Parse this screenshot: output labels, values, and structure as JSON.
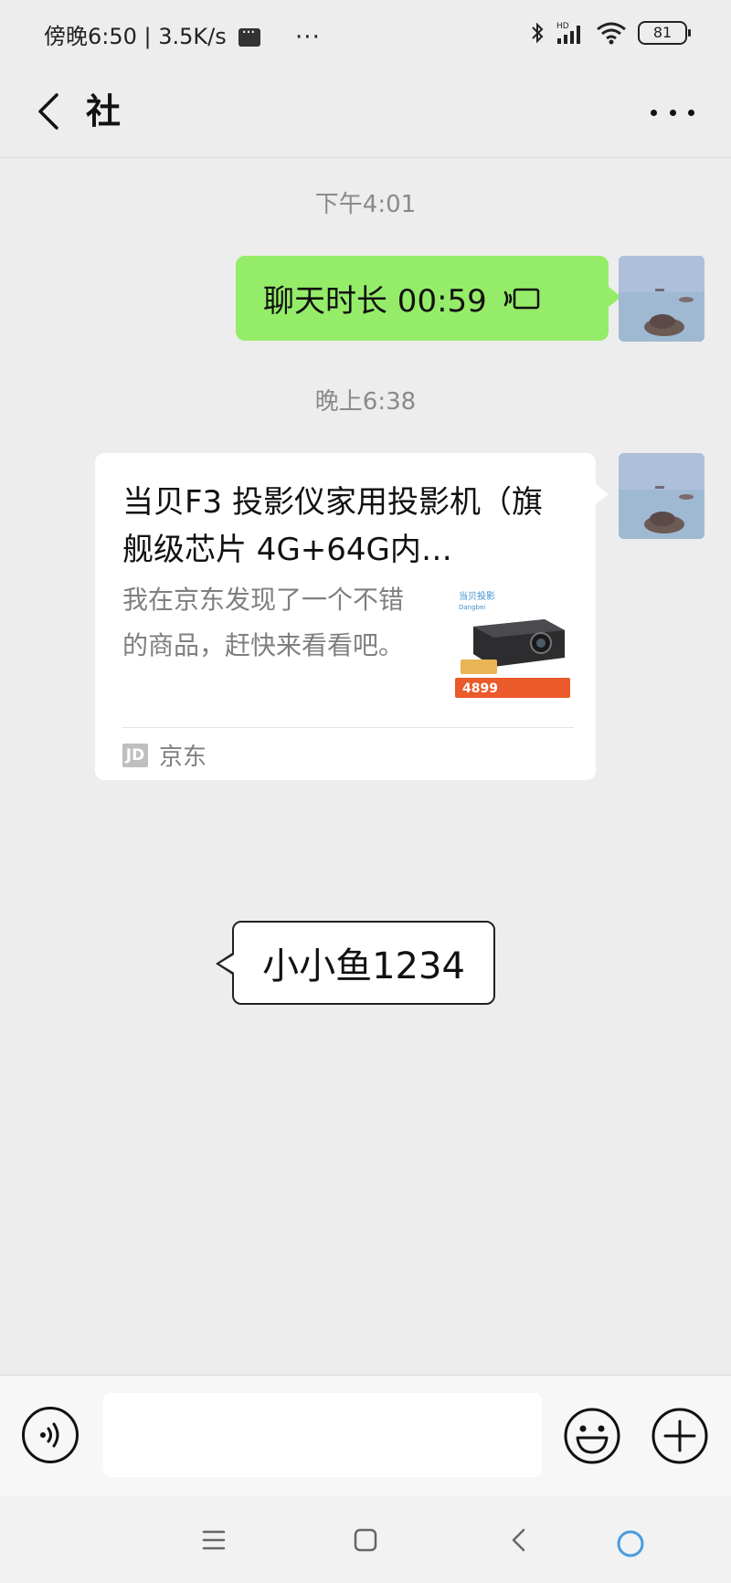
{
  "status_bar": {
    "time": "傍晚6:50",
    "network_speed": "3.5K/s",
    "battery": "81",
    "message_icon": "message-icon",
    "more_icon": "more-dots-icon",
    "bluetooth_icon": "bluetooth-icon",
    "signal_icon": "signal-hd-icon",
    "wifi_icon": "wifi-icon"
  },
  "header": {
    "title": "社",
    "back_icon": "chevron-left-icon",
    "more_icon": "more-horizontal-icon"
  },
  "messages": [
    {
      "type": "timestamp",
      "text": "下午4:01"
    },
    {
      "type": "voice_call",
      "sender": "self",
      "text": "聊天时长 00:59",
      "icon": "call-record-icon",
      "bubble_color": "#95ec69"
    },
    {
      "type": "timestamp",
      "text": "晚上6:38"
    },
    {
      "type": "link_card",
      "sender": "self",
      "title": "当贝F3 投影仪家用投影机（旗舰级芯片 4G+64G内…",
      "description": "我在京东发现了一个不错的商品，赶快来看看吧。",
      "source": "京东",
      "source_logo": "JD",
      "thumbnail": {
        "brand_text": "当贝投影",
        "brand_sub": "Dangbei",
        "price": "4899"
      }
    }
  ],
  "tooltip": {
    "text": "小小鱼1234"
  },
  "input_bar": {
    "placeholder": "",
    "voice_icon": "voice-icon",
    "emoji_icon": "emoji-icon",
    "plus_icon": "plus-icon"
  },
  "system_nav": {
    "menu_icon": "menu-icon",
    "home_icon": "home-icon",
    "back_icon": "back-icon"
  },
  "colors": {
    "background": "#ededed",
    "self_bubble": "#95ec69",
    "card_bg": "#ffffff",
    "muted_text": "#7f7f7f"
  }
}
